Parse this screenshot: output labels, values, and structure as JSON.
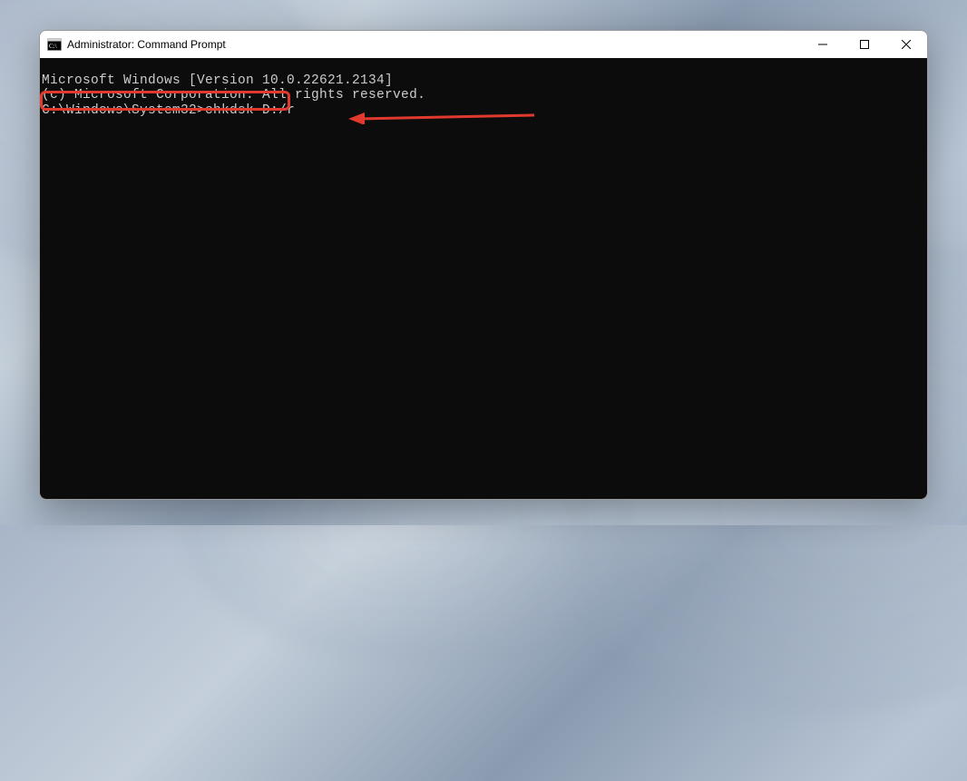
{
  "window": {
    "title": "Administrator: Command Prompt"
  },
  "terminal": {
    "line1": "Microsoft Windows [Version 10.0.22621.2134]",
    "line2": "(c) Microsoft Corporation. All rights reserved.",
    "blank": "",
    "prompt_path": "C:\\Windows\\System32>",
    "command": "chkdsk D:/r"
  },
  "annotation": {
    "highlight": "command-highlight",
    "arrow": "arrow-pointer"
  }
}
